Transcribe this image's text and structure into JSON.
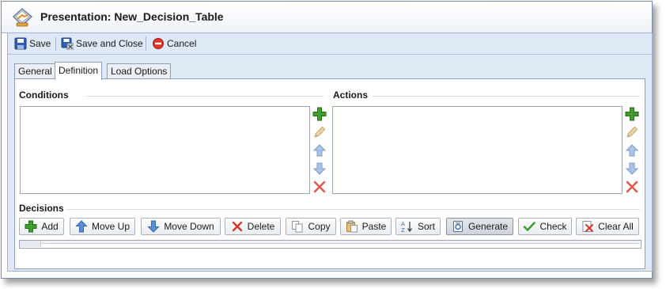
{
  "window": {
    "title": "Presentation: New_Decision_Table",
    "icon": "presentation-icon"
  },
  "toolbar": {
    "save_label": "Save",
    "save_close_label": "Save and Close",
    "cancel_label": "Cancel"
  },
  "tabs": [
    {
      "label": "General",
      "active": false
    },
    {
      "label": "Definition",
      "active": true
    },
    {
      "label": "Load Options",
      "active": false
    }
  ],
  "conditions": {
    "heading": "Conditions",
    "side_buttons": [
      "add-icon",
      "edit-icon",
      "move-up-icon",
      "move-down-icon",
      "delete-icon"
    ]
  },
  "actions": {
    "heading": "Actions",
    "side_buttons": [
      "add-icon",
      "edit-icon",
      "move-up-icon",
      "move-down-icon",
      "delete-icon"
    ]
  },
  "decisions": {
    "heading": "Decisions",
    "buttons": [
      {
        "label": "Add",
        "icon": "add-icon"
      },
      {
        "label": "Move Up",
        "icon": "arrow-up-icon"
      },
      {
        "label": "Move Down",
        "icon": "arrow-down-icon"
      },
      {
        "label": "Delete",
        "icon": "delete-icon"
      },
      {
        "label": "Copy",
        "icon": "copy-icon"
      },
      {
        "label": "Paste",
        "icon": "paste-icon"
      },
      {
        "label": "Sort",
        "icon": "sort-icon"
      },
      {
        "label": "Generate",
        "icon": "generate-icon",
        "pressed": true
      },
      {
        "label": "Check",
        "icon": "check-icon"
      },
      {
        "label": "Clear All",
        "icon": "clear-all-icon"
      }
    ]
  },
  "colors": {
    "chrome": "#dfe8f5",
    "border": "#8f9fb8",
    "green": "#3f9e2e",
    "blue": "#5b8fd6",
    "red": "#d9352a"
  }
}
